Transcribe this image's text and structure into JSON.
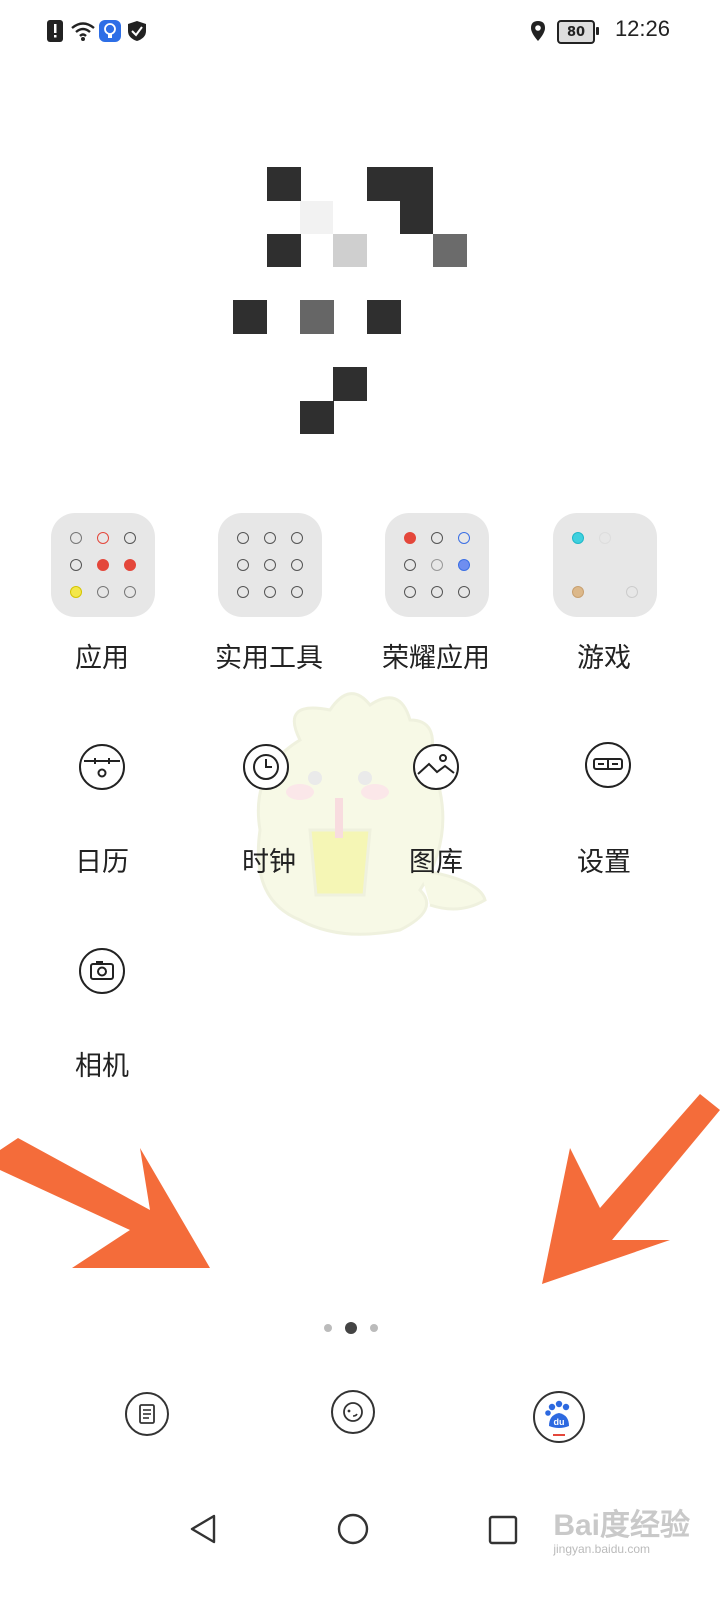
{
  "status_bar": {
    "time": "12:26",
    "battery": "80",
    "icons": [
      "alert-icon",
      "wifi-icon",
      "bulb-icon",
      "shield-icon",
      "location-icon"
    ]
  },
  "folders": [
    {
      "label": "应用"
    },
    {
      "label": "实用工具"
    },
    {
      "label": "荣耀应用"
    },
    {
      "label": "游戏"
    }
  ],
  "apps": [
    {
      "label": "日历",
      "icon": "calendar-icon"
    },
    {
      "label": "时钟",
      "icon": "clock-icon"
    },
    {
      "label": "图库",
      "icon": "gallery-icon"
    },
    {
      "label": "设置",
      "icon": "settings-icon"
    },
    {
      "label": "相机",
      "icon": "camera-icon"
    }
  ],
  "page_indicator": {
    "pages": 3,
    "current": 2
  },
  "dock": [
    "notes-icon",
    "browser-icon",
    "baidu-icon"
  ],
  "navigation": [
    "back-icon",
    "home-icon",
    "recents-icon"
  ],
  "watermark": {
    "brand": "Bai度经验",
    "url": "jingyan.baidu.com"
  },
  "colors": {
    "arrow": "#f46c3a",
    "baidu_blue": "#2d69e0",
    "folder_bg": "#e7e7e7"
  }
}
